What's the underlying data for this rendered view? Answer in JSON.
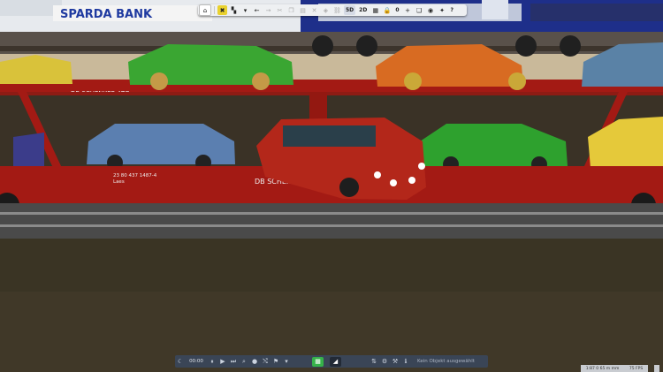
{
  "scene": {
    "banner_text": "SPARDA BANK",
    "wagon_label": "DB SCHENKER ATG",
    "wagon_label_lower": "DB SCHENKER",
    "wagon_number": "23 80 437 1487-4",
    "wagon_type": "Laes"
  },
  "top_toolbar": {
    "mode_2d5_label": "5D",
    "mode_2d_label": "2D",
    "counter_value": "0",
    "help_label": "?"
  },
  "bottom_bar": {
    "time_value": "00:00",
    "status_text": "Kein Objekt ausgewählt"
  },
  "status": {
    "coords": "1:87  0 65 m mm",
    "fps": "75 FPS"
  },
  "colors": {
    "wagon_red": "#a31a14",
    "active_tool": "#e9d12e",
    "play_green": "#36b24a"
  }
}
